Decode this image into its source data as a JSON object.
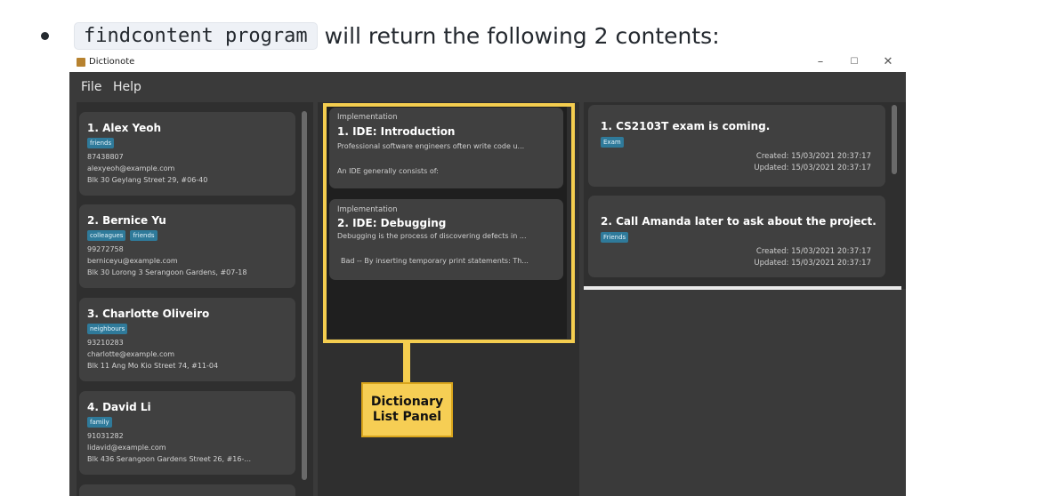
{
  "doc": {
    "command": "findcontent program",
    "sentence": "will return the following 2 contents:"
  },
  "window": {
    "title": "Dictionote",
    "controls": {
      "minimize": "–",
      "maximize": "☐",
      "close": "✕"
    }
  },
  "menu": {
    "items": [
      "File",
      "Help"
    ]
  },
  "contacts": [
    {
      "name": "1.  Alex Yeoh",
      "tags": [
        "friends"
      ],
      "phone": "87438807",
      "email": "alexyeoh@example.com",
      "address": "Blk 30 Geylang Street 29, #06-40"
    },
    {
      "name": "2.  Bernice Yu",
      "tags": [
        "colleagues",
        "friends"
      ],
      "phone": "99272758",
      "email": "berniceyu@example.com",
      "address": "Blk 30 Lorong 3 Serangoon Gardens, #07-18"
    },
    {
      "name": "3.  Charlotte Oliveiro",
      "tags": [
        "neighbours"
      ],
      "phone": "93210283",
      "email": "charlotte@example.com",
      "address": "Blk 11 Ang Mo Kio Street 74, #11-04"
    },
    {
      "name": "4.  David Li",
      "tags": [
        "family"
      ],
      "phone": "91031282",
      "email": "lidavid@example.com",
      "address": "Blk 436 Serangoon Gardens Street 26, #16-..."
    }
  ],
  "dictionary": [
    {
      "category": "Implementation",
      "title": "1.  IDE: Introduction",
      "line1": "Professional software engineers often write code u...",
      "line2": "An IDE generally consists of:"
    },
    {
      "category": "Implementation",
      "title": "2.  IDE: Debugging",
      "line1": "Debugging is the process of discovering defects in ...",
      "line2": "Bad -- By inserting temporary print statements: Th..."
    }
  ],
  "notes": [
    {
      "title": "1.  CS2103T exam is coming.",
      "tag": "Exam",
      "created": "Created: 15/03/2021 20:37:17",
      "updated": "Updated: 15/03/2021 20:37:17"
    },
    {
      "title": "2.  Call Amanda later to ask about the project.",
      "tag": "Friends",
      "created": "Created: 15/03/2021 20:37:17",
      "updated": "Updated: 15/03/2021 20:37:17"
    }
  ],
  "callout": {
    "line1": "Dictionary",
    "line2": "List Panel"
  },
  "colors": {
    "highlight": "#f4cd4f",
    "tag": "#2f7a9a",
    "panel": "#2f2f2f",
    "card": "#404040"
  }
}
